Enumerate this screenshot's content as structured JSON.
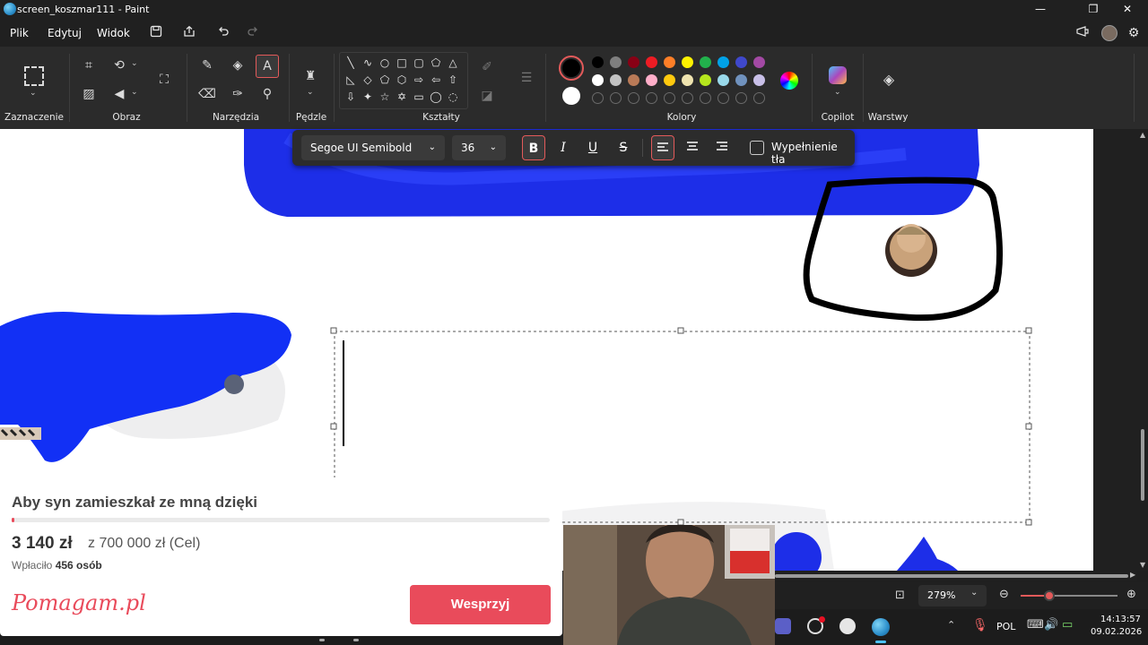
{
  "window": {
    "title": "screen_koszmar111 - Paint",
    "controls": [
      "—",
      "❐",
      "✕"
    ]
  },
  "menu": {
    "items": [
      "Plik",
      "Edytuj",
      "Widok"
    ]
  },
  "ribbon": {
    "groups": {
      "selection": "Zaznaczenie",
      "image": "Obraz",
      "tools": "Narzędzia",
      "brushes": "Pędzle",
      "shapes": "Kształty",
      "colors": "Kolory",
      "copilot": "Copilot",
      "layers": "Warstwy"
    },
    "swatches_row1": [
      "#000000",
      "#7f7f7f",
      "#880015",
      "#ed1c24",
      "#ff7f27",
      "#fff200",
      "#22b14c",
      "#00a2e8",
      "#3f48cc",
      "#a349a4"
    ],
    "swatches_row2": [
      "#ffffff",
      "#c3c3c3",
      "#b97a57",
      "#ffaec9",
      "#ffc90e",
      "#efe4b0",
      "#b5e61d",
      "#99d9ea",
      "#7092be",
      "#c8bfe7"
    ],
    "primary_color": "#000000",
    "secondary_color": "#ffffff",
    "accent_color": "#e35a5a"
  },
  "text_toolbar": {
    "font": "Segoe UI Semibold",
    "size": "36",
    "bold": "B",
    "italic": "I",
    "underline": "U",
    "strike": "S",
    "fill_label": "Wypełnienie tła"
  },
  "status": {
    "zoom": "279%"
  },
  "taskbar": {
    "lang": "POL",
    "time": "14:13:57",
    "date": "09.02.2026"
  },
  "fundraiser": {
    "title": "Aby syn zamieszkał ze mną dzięki",
    "raised": "3 140 zł",
    "goal": "z 700 000 zł (Cel)",
    "donors_prefix": "Wpłaciło",
    "donors_count": "456 osób",
    "brand": "Pomagam.pl",
    "cta": "Wesprzyj",
    "progress_fraction": 0.0045,
    "brand_color": "#e94b5b"
  }
}
